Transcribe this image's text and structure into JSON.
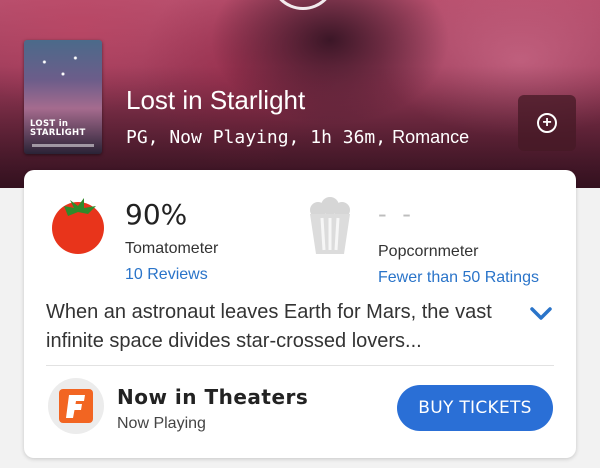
{
  "hero": {
    "poster_title": "LOST in STARLIGHT",
    "title": "Lost in Starlight",
    "meta": "PG, Now Playing, 1h 36m,",
    "genre": "Romance"
  },
  "scores": {
    "tomatometer": {
      "score": "90%",
      "label": "Tomatometer",
      "link": "10 Reviews"
    },
    "popcornmeter": {
      "score": "- -",
      "label": "Popcornmeter",
      "link": "Fewer than 50 Ratings"
    }
  },
  "synopsis": "When an astronaut leaves Earth for Mars, the vast infinite space divides star-crossed lovers...",
  "theaters": {
    "title": "Now in Theaters",
    "subtitle": "Now Playing",
    "button": "BUY TICKETS"
  },
  "colors": {
    "accent": "#2a6fd6",
    "link": "#2a74c9",
    "tomato": "#e8341b",
    "fandango": "#f26522"
  },
  "icons": {
    "add": "plus-circle-icon",
    "expand": "chevron-down-icon",
    "tomatometer": "tomato-icon",
    "popcornmeter": "popcorn-bucket-icon",
    "theaters": "fandango-logo"
  }
}
